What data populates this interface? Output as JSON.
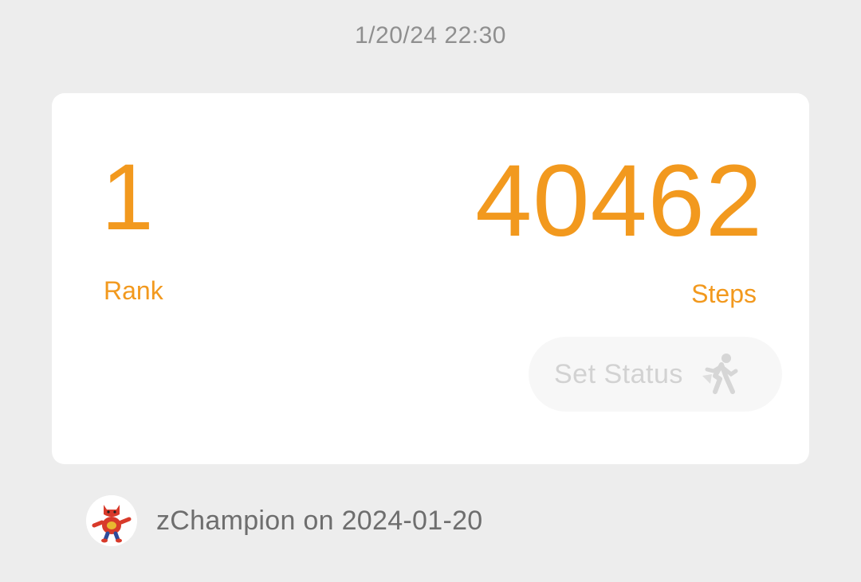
{
  "timestamp": "1/20/24 22:30",
  "card": {
    "rank_value": "1",
    "rank_label": "Rank",
    "steps_value": "40462",
    "steps_label": "Steps",
    "status_button_label": "Set Status",
    "status_icon": "walking-person-icon"
  },
  "footer": {
    "avatar_icon": "champion-mascot-avatar",
    "text": "zChampion on 2024-01-20"
  },
  "colors": {
    "accent": "#f2991e",
    "background": "#ededed",
    "card": "#ffffff",
    "muted_text": "#8f8f8f",
    "button_bg": "#f7f7f7",
    "button_text": "#d2d2d2"
  }
}
